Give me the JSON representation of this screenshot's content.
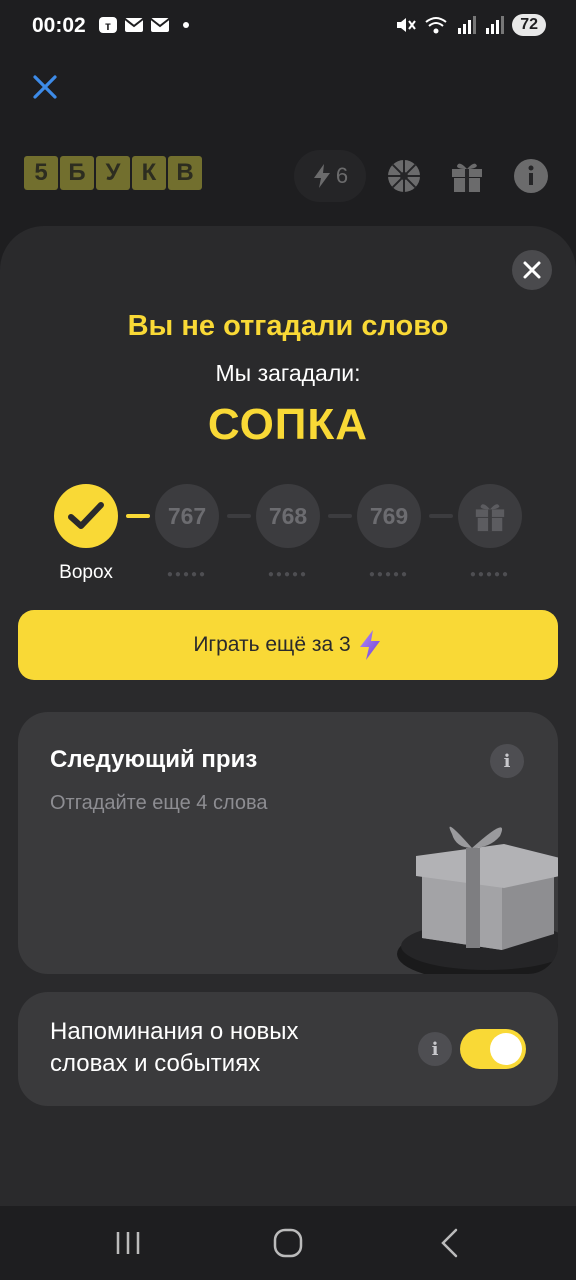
{
  "status_bar": {
    "time": "00:02",
    "battery": "72"
  },
  "header": {
    "logo_letters": [
      "5",
      "Б",
      "У",
      "К",
      "В"
    ],
    "energy_count": "6"
  },
  "result": {
    "title": "Вы не отгадали слово",
    "subtitle": "Мы загадали:",
    "word": "СОПКА"
  },
  "progress": {
    "completed_label": "Ворох",
    "steps": [
      "767",
      "768",
      "769"
    ],
    "dots": "●●●●●"
  },
  "play_button": {
    "label": "Играть ещё за 3"
  },
  "prize": {
    "title": "Следующий приз",
    "subtitle": "Отгадайте еще 4 слова"
  },
  "reminders": {
    "label": "Напоминания о новых словах и событиях",
    "enabled": true
  },
  "info_glyph": "i",
  "colors": {
    "accent": "#f9d936",
    "background": "#1e1e20",
    "sheet": "#2a2a2c",
    "card": "#3a3a3c",
    "close_blue": "#3d8be8"
  }
}
